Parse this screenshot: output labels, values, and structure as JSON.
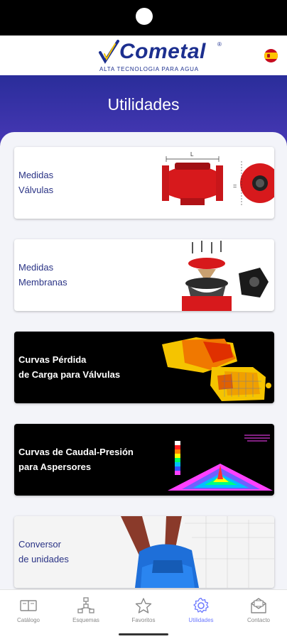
{
  "header": {
    "brand": "Cometal",
    "brand_mark": "®",
    "tagline": "ALTA TECNOLOGIA PARA AGUA",
    "language_flag": "spain-flag-icon"
  },
  "page": {
    "title": "Utilidades"
  },
  "cards": [
    {
      "line1": "Medidas",
      "line2": "Válvulas",
      "theme": "light"
    },
    {
      "line1": "Medidas",
      "line2": "Membranas",
      "theme": "light"
    },
    {
      "line1": "Curvas Pérdida",
      "line2": "de Carga para Válvulas",
      "theme": "dark"
    },
    {
      "line1": "Curvas de Caudal-Presión",
      "line2": "para Aspersores",
      "theme": "dark"
    },
    {
      "line1": "Conversor",
      "line2": "de unidades",
      "theme": "light"
    }
  ],
  "nav": {
    "items": [
      {
        "label": "Catálogo",
        "icon": "book-icon"
      },
      {
        "label": "Esquemas",
        "icon": "diagram-icon"
      },
      {
        "label": "Favoritos",
        "icon": "star-icon"
      },
      {
        "label": "Utilidades",
        "icon": "gear-icon",
        "active": true
      },
      {
        "label": "Contacto",
        "icon": "mail-icon"
      }
    ]
  },
  "colors": {
    "brand_blue": "#1c2f8f",
    "hero_top": "#2a2d9a",
    "hero_bottom": "#4a39b8",
    "active_nav": "#6b78ff",
    "valve_red": "#d7191c"
  }
}
